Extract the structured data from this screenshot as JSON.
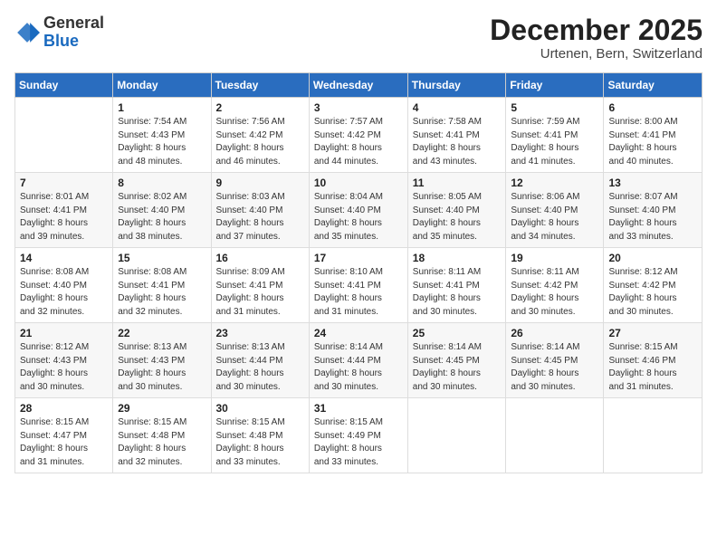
{
  "header": {
    "logo_general": "General",
    "logo_blue": "Blue",
    "month_title": "December 2025",
    "location": "Urtenen, Bern, Switzerland"
  },
  "days_of_week": [
    "Sunday",
    "Monday",
    "Tuesday",
    "Wednesday",
    "Thursday",
    "Friday",
    "Saturday"
  ],
  "weeks": [
    [
      {
        "num": "",
        "info": ""
      },
      {
        "num": "1",
        "info": "Sunrise: 7:54 AM\nSunset: 4:43 PM\nDaylight: 8 hours\nand 48 minutes."
      },
      {
        "num": "2",
        "info": "Sunrise: 7:56 AM\nSunset: 4:42 PM\nDaylight: 8 hours\nand 46 minutes."
      },
      {
        "num": "3",
        "info": "Sunrise: 7:57 AM\nSunset: 4:42 PM\nDaylight: 8 hours\nand 44 minutes."
      },
      {
        "num": "4",
        "info": "Sunrise: 7:58 AM\nSunset: 4:41 PM\nDaylight: 8 hours\nand 43 minutes."
      },
      {
        "num": "5",
        "info": "Sunrise: 7:59 AM\nSunset: 4:41 PM\nDaylight: 8 hours\nand 41 minutes."
      },
      {
        "num": "6",
        "info": "Sunrise: 8:00 AM\nSunset: 4:41 PM\nDaylight: 8 hours\nand 40 minutes."
      }
    ],
    [
      {
        "num": "7",
        "info": "Sunrise: 8:01 AM\nSunset: 4:41 PM\nDaylight: 8 hours\nand 39 minutes."
      },
      {
        "num": "8",
        "info": "Sunrise: 8:02 AM\nSunset: 4:40 PM\nDaylight: 8 hours\nand 38 minutes."
      },
      {
        "num": "9",
        "info": "Sunrise: 8:03 AM\nSunset: 4:40 PM\nDaylight: 8 hours\nand 37 minutes."
      },
      {
        "num": "10",
        "info": "Sunrise: 8:04 AM\nSunset: 4:40 PM\nDaylight: 8 hours\nand 35 minutes."
      },
      {
        "num": "11",
        "info": "Sunrise: 8:05 AM\nSunset: 4:40 PM\nDaylight: 8 hours\nand 35 minutes."
      },
      {
        "num": "12",
        "info": "Sunrise: 8:06 AM\nSunset: 4:40 PM\nDaylight: 8 hours\nand 34 minutes."
      },
      {
        "num": "13",
        "info": "Sunrise: 8:07 AM\nSunset: 4:40 PM\nDaylight: 8 hours\nand 33 minutes."
      }
    ],
    [
      {
        "num": "14",
        "info": "Sunrise: 8:08 AM\nSunset: 4:40 PM\nDaylight: 8 hours\nand 32 minutes."
      },
      {
        "num": "15",
        "info": "Sunrise: 8:08 AM\nSunset: 4:41 PM\nDaylight: 8 hours\nand 32 minutes."
      },
      {
        "num": "16",
        "info": "Sunrise: 8:09 AM\nSunset: 4:41 PM\nDaylight: 8 hours\nand 31 minutes."
      },
      {
        "num": "17",
        "info": "Sunrise: 8:10 AM\nSunset: 4:41 PM\nDaylight: 8 hours\nand 31 minutes."
      },
      {
        "num": "18",
        "info": "Sunrise: 8:11 AM\nSunset: 4:41 PM\nDaylight: 8 hours\nand 30 minutes."
      },
      {
        "num": "19",
        "info": "Sunrise: 8:11 AM\nSunset: 4:42 PM\nDaylight: 8 hours\nand 30 minutes."
      },
      {
        "num": "20",
        "info": "Sunrise: 8:12 AM\nSunset: 4:42 PM\nDaylight: 8 hours\nand 30 minutes."
      }
    ],
    [
      {
        "num": "21",
        "info": "Sunrise: 8:12 AM\nSunset: 4:43 PM\nDaylight: 8 hours\nand 30 minutes."
      },
      {
        "num": "22",
        "info": "Sunrise: 8:13 AM\nSunset: 4:43 PM\nDaylight: 8 hours\nand 30 minutes."
      },
      {
        "num": "23",
        "info": "Sunrise: 8:13 AM\nSunset: 4:44 PM\nDaylight: 8 hours\nand 30 minutes."
      },
      {
        "num": "24",
        "info": "Sunrise: 8:14 AM\nSunset: 4:44 PM\nDaylight: 8 hours\nand 30 minutes."
      },
      {
        "num": "25",
        "info": "Sunrise: 8:14 AM\nSunset: 4:45 PM\nDaylight: 8 hours\nand 30 minutes."
      },
      {
        "num": "26",
        "info": "Sunrise: 8:14 AM\nSunset: 4:45 PM\nDaylight: 8 hours\nand 30 minutes."
      },
      {
        "num": "27",
        "info": "Sunrise: 8:15 AM\nSunset: 4:46 PM\nDaylight: 8 hours\nand 31 minutes."
      }
    ],
    [
      {
        "num": "28",
        "info": "Sunrise: 8:15 AM\nSunset: 4:47 PM\nDaylight: 8 hours\nand 31 minutes."
      },
      {
        "num": "29",
        "info": "Sunrise: 8:15 AM\nSunset: 4:48 PM\nDaylight: 8 hours\nand 32 minutes."
      },
      {
        "num": "30",
        "info": "Sunrise: 8:15 AM\nSunset: 4:48 PM\nDaylight: 8 hours\nand 33 minutes."
      },
      {
        "num": "31",
        "info": "Sunrise: 8:15 AM\nSunset: 4:49 PM\nDaylight: 8 hours\nand 33 minutes."
      },
      {
        "num": "",
        "info": ""
      },
      {
        "num": "",
        "info": ""
      },
      {
        "num": "",
        "info": ""
      }
    ]
  ]
}
